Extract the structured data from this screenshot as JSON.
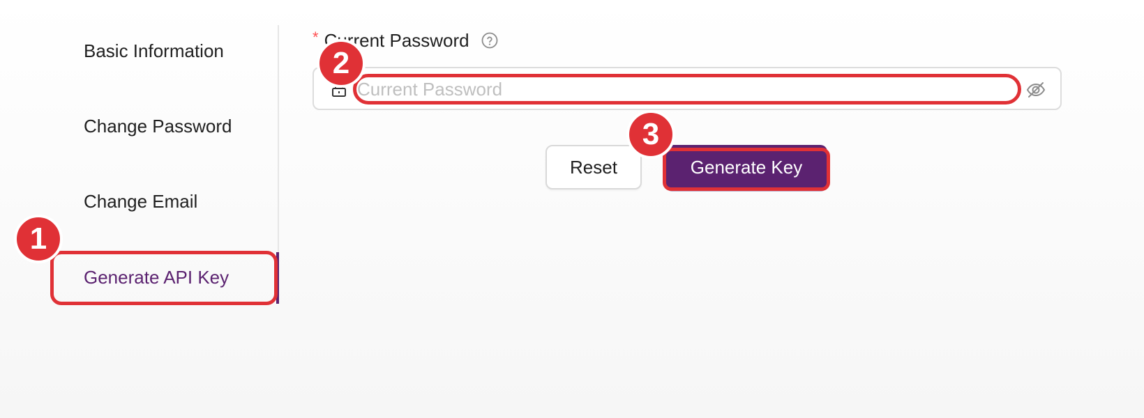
{
  "colors": {
    "accent": "#5b2270",
    "annotation": "#e03136",
    "required": "#ff4d4f"
  },
  "sidebar": {
    "items": [
      {
        "label": "Basic Information",
        "active": false
      },
      {
        "label": "Change Password",
        "active": false
      },
      {
        "label": "Change Email",
        "active": false
      },
      {
        "label": "Generate API Key",
        "active": true
      }
    ]
  },
  "form": {
    "required_marker": "*",
    "label": "Current Password",
    "help_icon": "question-circle-icon",
    "input": {
      "value": "",
      "placeholder": "Current Password",
      "prefix_icon": "lock-icon",
      "suffix_icon": "eye-slash-icon"
    },
    "reset_label": "Reset",
    "submit_label": "Generate Key"
  },
  "annotations": {
    "steps": [
      "1",
      "2",
      "3"
    ]
  }
}
